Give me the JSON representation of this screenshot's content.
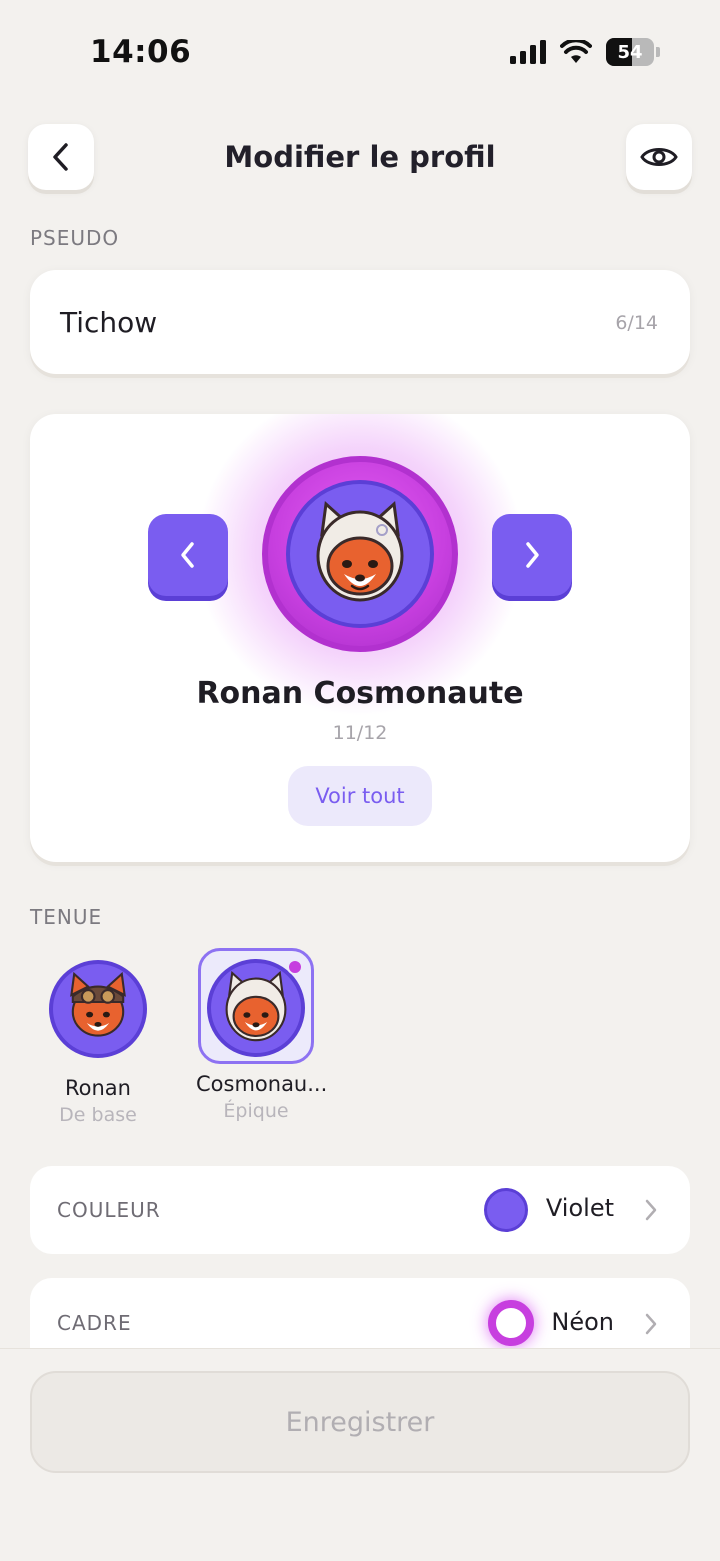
{
  "status_bar": {
    "time": "14:06",
    "battery": "54"
  },
  "header": {
    "title": "Modifier le profil"
  },
  "pseudo": {
    "label": "PSEUDO",
    "value": "Tichow",
    "count": "6/14"
  },
  "avatar": {
    "name": "Ronan Cosmonaute",
    "count": "11/12",
    "see_all": "Voir tout"
  },
  "outfit": {
    "label": "TENUE",
    "items": [
      {
        "name": "Ronan",
        "rarity": "De base"
      },
      {
        "name": "Cosmonau...",
        "rarity": "Épique"
      }
    ]
  },
  "settings": {
    "color": {
      "label": "COULEUR",
      "value": "Violet",
      "swatch": "#7a5df0"
    },
    "frame": {
      "label": "CADRE",
      "value": "Néon",
      "swatch": "#c73fdf"
    }
  },
  "footer": {
    "save_label": "Enregistrer"
  },
  "colors": {
    "accent": "#7a5df0",
    "neon": "#c73fdf",
    "background": "#f3f1ee"
  }
}
